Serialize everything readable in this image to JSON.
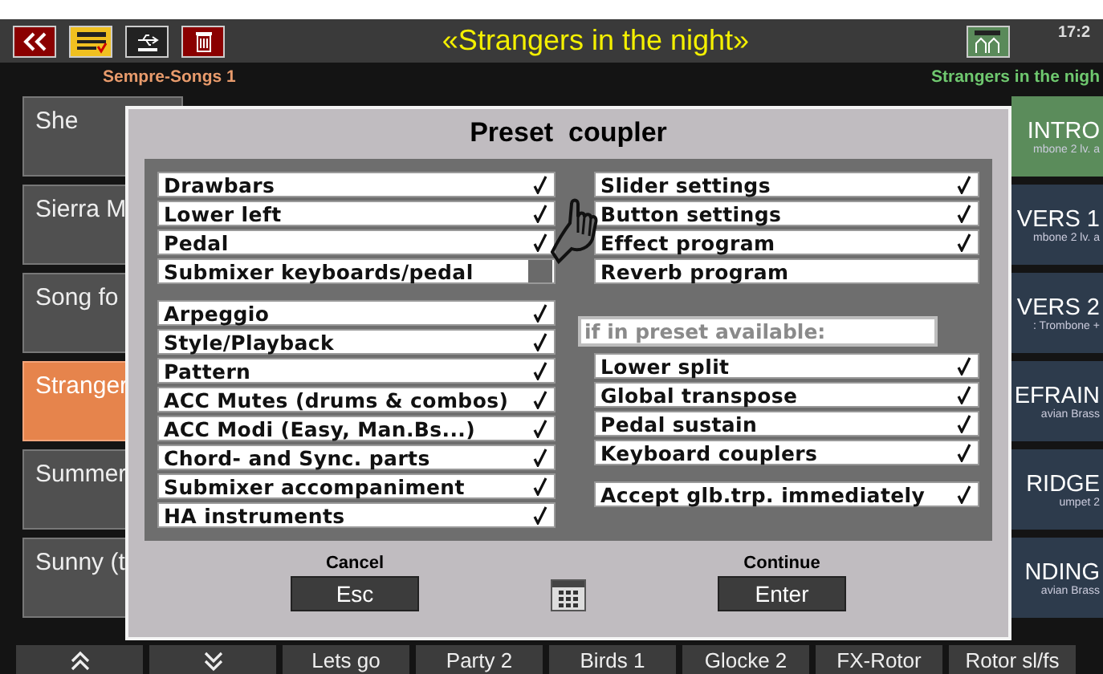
{
  "top_bar": {
    "title": "«Strangers in the night»",
    "time": "17:2"
  },
  "header": {
    "left": "Sempre-Songs 1",
    "right": "Strangers in the nigh"
  },
  "songs": [
    {
      "label": "She",
      "selected": false
    },
    {
      "label": "Sierra M",
      "selected": false
    },
    {
      "label": "Song fo",
      "selected": false
    },
    {
      "label": "Stranger",
      "selected": true
    },
    {
      "label": "Summer",
      "selected": false
    },
    {
      "label": "Sunny (t",
      "selected": false
    }
  ],
  "parts": [
    {
      "label": "INTRO",
      "sub": "mbone 2 lv. a",
      "selected": true
    },
    {
      "label": "VERS 1",
      "sub": "mbone 2 lv. a",
      "selected": false
    },
    {
      "label": "VERS 2",
      "sub": ": Trombone +",
      "selected": false
    },
    {
      "label": "EFRAIN",
      "sub": "avian Brass",
      "selected": false
    },
    {
      "label": "RIDGE",
      "sub": "umpet 2",
      "selected": false
    },
    {
      "label": "NDING",
      "sub": "avian Brass",
      "selected": false
    }
  ],
  "dialog": {
    "title": "Preset  coupler",
    "columns": [
      {
        "sections": [
          {
            "items": [
              {
                "label": "Drawbars",
                "checked": true,
                "disabled": false
              },
              {
                "label": "Lower left",
                "checked": true,
                "disabled": false
              },
              {
                "label": "Pedal",
                "checked": true,
                "disabled": false
              },
              {
                "label": "Submixer keyboards/pedal",
                "checked": false,
                "disabled": true
              }
            ]
          },
          {
            "items": [
              {
                "label": "Arpeggio",
                "checked": true,
                "disabled": false
              },
              {
                "label": "Style/Playback",
                "checked": true,
                "disabled": false
              },
              {
                "label": "Pattern",
                "checked": true,
                "disabled": false
              },
              {
                "label": "ACC Mutes (drums & combos)",
                "checked": true,
                "disabled": false
              },
              {
                "label": "ACC Modi (Easy, Man.Bs...)",
                "checked": true,
                "disabled": false
              },
              {
                "label": "Chord- and Sync. parts",
                "checked": true,
                "disabled": false
              },
              {
                "label": "Submixer accompaniment",
                "checked": true,
                "disabled": false
              },
              {
                "label": "HA instruments",
                "checked": true,
                "disabled": false
              }
            ]
          }
        ]
      },
      {
        "sections": [
          {
            "items": [
              {
                "label": "Slider settings",
                "checked": true,
                "disabled": false
              },
              {
                "label": "Button settings",
                "checked": true,
                "disabled": false
              },
              {
                "label": "Effect program",
                "checked": true,
                "disabled": false
              },
              {
                "label": "Reverb program",
                "checked": false,
                "disabled": false
              }
            ]
          },
          {
            "note": "if in preset available:",
            "items": [
              {
                "label": "Lower split",
                "checked": true,
                "disabled": false
              },
              {
                "label": "Global transpose",
                "checked": true,
                "disabled": false
              },
              {
                "label": "Pedal sustain",
                "checked": true,
                "disabled": false
              },
              {
                "label": "Keyboard couplers",
                "checked": true,
                "disabled": false
              }
            ]
          },
          {
            "items": [
              {
                "label": "Accept glb.trp. immediately",
                "checked": true,
                "disabled": false
              }
            ]
          }
        ]
      }
    ],
    "buttons": [
      {
        "caption": "Cancel",
        "label": "Esc"
      },
      {
        "caption": "Continue",
        "label": "Enter"
      }
    ]
  },
  "bottom_bar": [
    {
      "kind": "up"
    },
    {
      "kind": "down"
    },
    {
      "kind": "text",
      "label": "Lets go"
    },
    {
      "kind": "text",
      "label": "Party 2"
    },
    {
      "kind": "text",
      "label": "Birds 1"
    },
    {
      "kind": "text",
      "label": "Glocke 2"
    },
    {
      "kind": "text",
      "label": "FX-Rotor"
    },
    {
      "kind": "text",
      "label": "Rotor sl/fs"
    }
  ]
}
